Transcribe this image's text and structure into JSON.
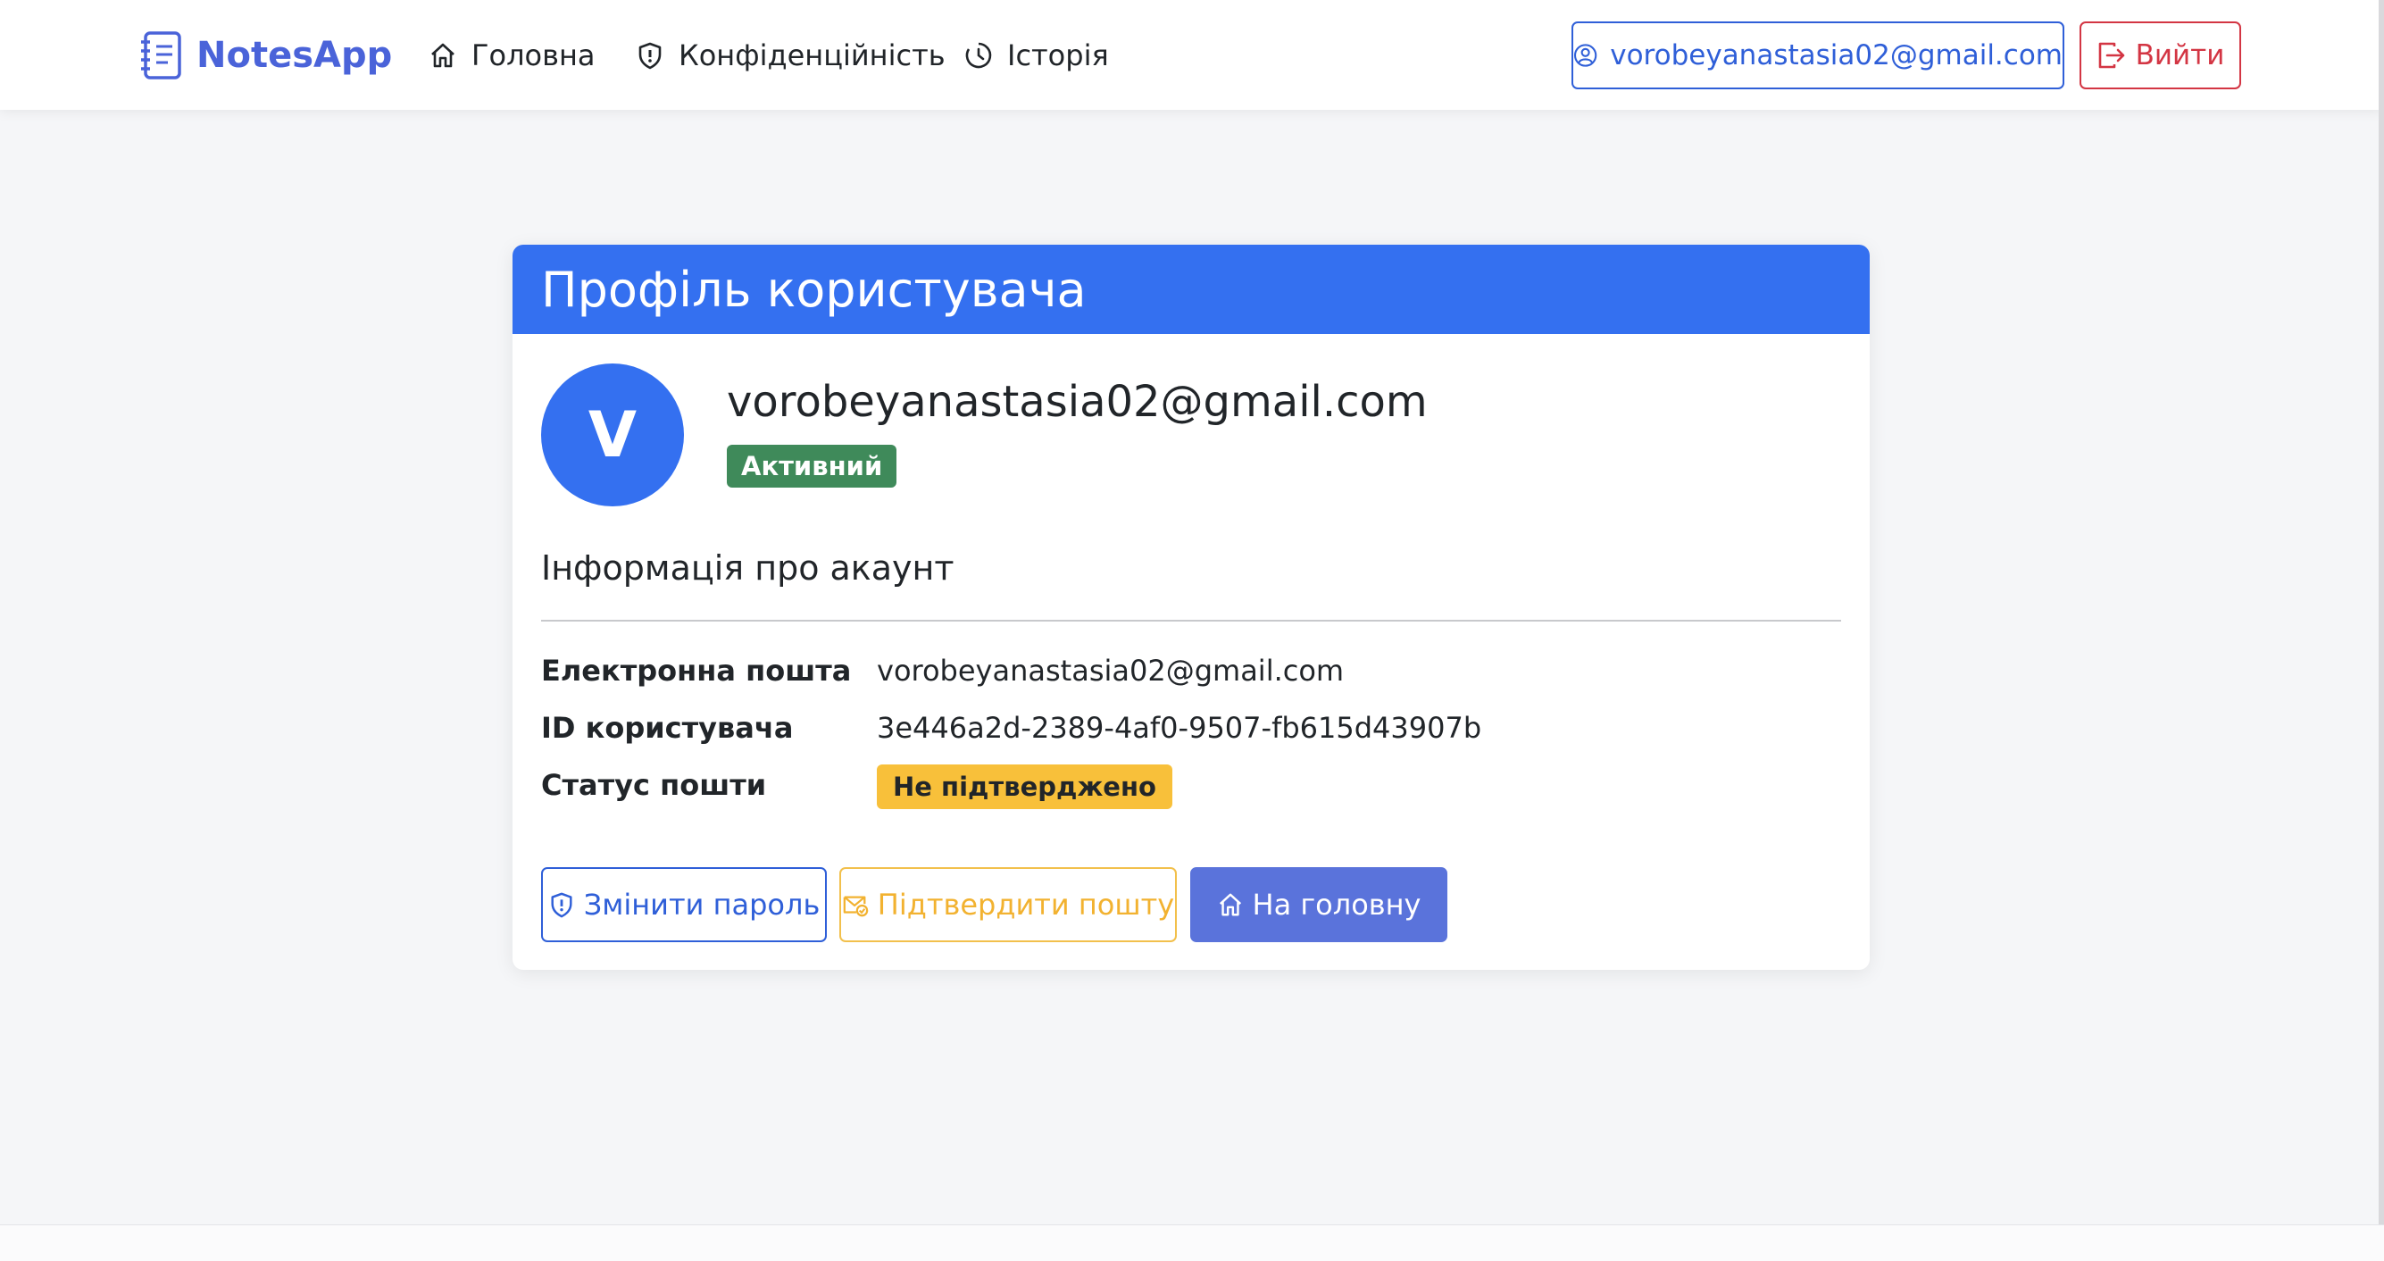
{
  "navbar": {
    "brand": "NotesApp",
    "links": [
      {
        "label": "Головна",
        "icon": "home-icon"
      },
      {
        "label": "Конфіденційність",
        "icon": "shield-icon"
      },
      {
        "label": "Історія",
        "icon": "clock-icon"
      }
    ],
    "user_button": {
      "label": "vorobeyanastasia02@gmail.com",
      "icon": "user-circle-icon"
    },
    "logout_button": {
      "label": "Вийти",
      "icon": "logout-icon"
    }
  },
  "card": {
    "title": "Профіль користувача",
    "avatar_letter": "V",
    "email": "vorobeyanastasia02@gmail.com",
    "status_badge": "Активний",
    "section_title": "Інформація про акаунт",
    "info": [
      {
        "label": "Електронна пошта",
        "value": "vorobeyanastasia02@gmail.com"
      },
      {
        "label": "ID користувача",
        "value": "3e446a2d-2389-4af0-9507-fb615d43907b"
      },
      {
        "label": "Статус пошти",
        "value": "Не підтверджено"
      }
    ],
    "buttons": {
      "change_password": "Змінити пароль",
      "verify_email": "Підтвердити пошту",
      "go_home": "На головну"
    }
  },
  "colors": {
    "primary": "#3470f0",
    "brand": "#4a63d9",
    "danger": "#d33543",
    "success": "#3f8a5a",
    "warning": "#f8c03a",
    "home_button": "#5a73db"
  }
}
